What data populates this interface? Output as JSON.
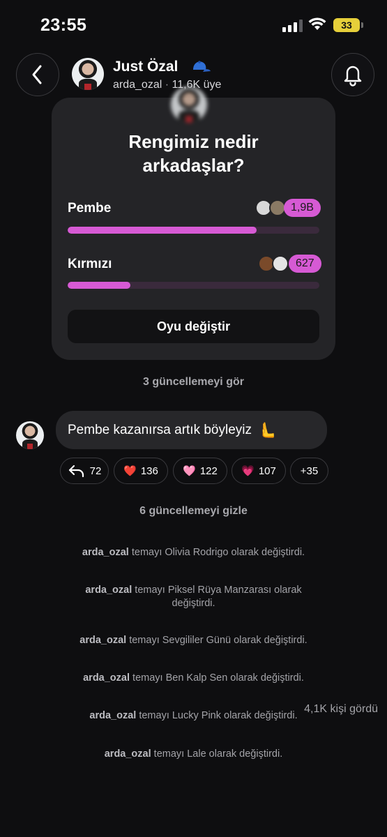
{
  "status_bar": {
    "time": "23:55",
    "battery": "33"
  },
  "header": {
    "name": "Just Özal",
    "username": "arda_ozal",
    "members": "11,6K üye"
  },
  "poll": {
    "question_line1": "Rengimiz nedir",
    "question_line2": "arkadaşlar?",
    "options": [
      {
        "label": "Pembe",
        "count": "1,9B",
        "fill_fraction": 0.75
      },
      {
        "label": "Kırmızı",
        "count": "627",
        "fill_fraction": 0.25
      }
    ],
    "change_vote_label": "Oyu değiştir"
  },
  "see_updates": "3 güncellemeyi gör",
  "message": {
    "text": "Pembe kazanırsa artık böyleyiz",
    "emoji": "🫷"
  },
  "reactions": [
    {
      "icon": "reply-icon",
      "symbol": "↰",
      "count": "72"
    },
    {
      "icon": "red-heart-icon",
      "symbol": "❤️",
      "count": "136"
    },
    {
      "icon": "pink-heart-icon",
      "symbol": "🩷",
      "count": "122"
    },
    {
      "icon": "sparkling-heart-icon",
      "symbol": "💗",
      "count": "107"
    },
    {
      "icon": "more-reactions",
      "symbol": "",
      "count": "+35"
    }
  ],
  "hide_updates": "6 güncellemeyi gizle",
  "theme_updates": [
    {
      "user": "arda_ozal",
      "text": "temayı Olivia Rodrigo olarak değiştirdi."
    },
    {
      "user": "arda_ozal",
      "text": "temayı Piksel Rüya Manzarası olarak değiştirdi."
    },
    {
      "user": "arda_ozal",
      "text": "temayı Sevgililer Günü olarak değiştirdi."
    },
    {
      "user": "arda_ozal",
      "text": "temayı Ben Kalp Sen olarak değiştirdi."
    },
    {
      "user": "arda_ozal",
      "text": "temayı Lucky Pink olarak değiştirdi."
    },
    {
      "user": "arda_ozal",
      "text": "temayı Lale olarak değiştirdi."
    }
  ],
  "seen_by": "4,1K kişi gördü",
  "colors": {
    "accent": "#d65ad4",
    "background": "#0e0e10",
    "card": "#242427"
  }
}
